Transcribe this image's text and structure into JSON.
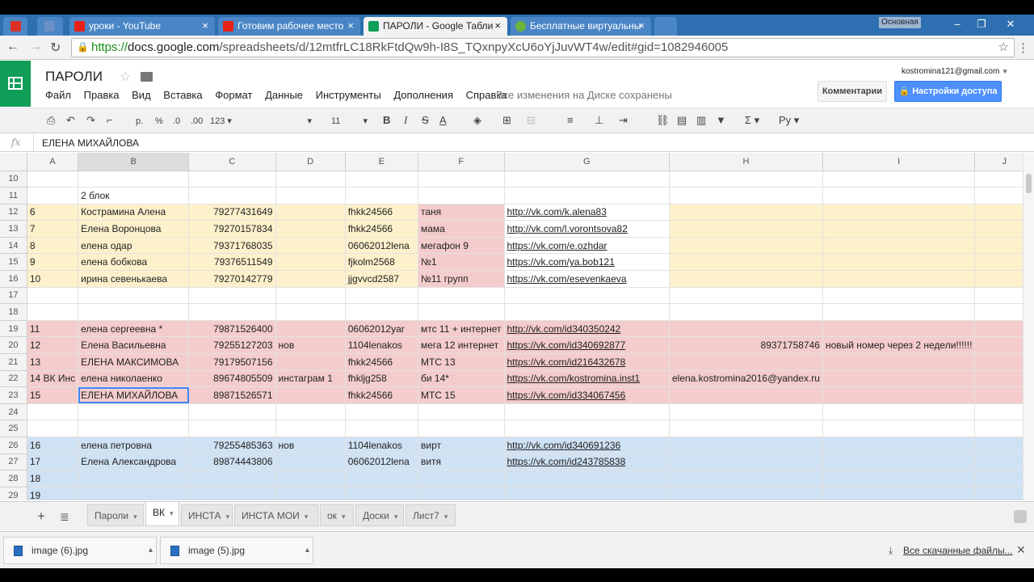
{
  "browser": {
    "tabs": [
      {
        "label": "",
        "favicon_color": "#d93025"
      },
      {
        "label": "",
        "favicon_color": "#6b8fc7"
      },
      {
        "label": "уроки - YouTube",
        "favicon_color": "#e62117"
      },
      {
        "label": "Готовим рабочее место",
        "favicon_color": "#e62117"
      },
      {
        "label": "ПАРОЛИ - Google Табли",
        "favicon_color": "#0f9d58"
      },
      {
        "label": "Бесплатные виртуальны",
        "favicon_color": "#6bb33a"
      }
    ],
    "profile_label": "Основная",
    "url_scheme": "https://",
    "url_host": "docs.google.com",
    "url_path": "/spreadsheets/d/12mtfrLC18RkFtdQw9h-I8S_TQxnpyXcU6oYjJuvWT4w/edit#gid=1082946005"
  },
  "doc": {
    "title": "ПАРОЛИ",
    "menu": [
      "Файл",
      "Правка",
      "Вид",
      "Вставка",
      "Формат",
      "Данные",
      "Инструменты",
      "Дополнения",
      "Справка"
    ],
    "saved_status": "Все изменения на Диске сохранены",
    "account": "kostromina121@gmail.com",
    "comments_label": "Комментарии",
    "share_label": "Настройки доступа"
  },
  "toolbar": {
    "currency": "р.",
    "percent": "%",
    "dec_less": ".0",
    "dec_more": ".00",
    "format_more": "123",
    "font_size": "11",
    "bold": "B",
    "italic": "I",
    "strike": "S",
    "text_color": "A",
    "sigma": "Σ",
    "input_lang": "Ру"
  },
  "formula": {
    "fx": "fx",
    "value": "ЕЛЕНА МИХАЙЛОВА"
  },
  "sheet": {
    "columns": [
      "A",
      "B",
      "C",
      "D",
      "E",
      "F",
      "G",
      "H",
      "I",
      "J"
    ],
    "selected_column": "B",
    "rows": [
      {
        "n": "10",
        "color": "",
        "cells": [
          "",
          "",
          "",
          "",
          "",
          "",
          "",
          "",
          "",
          ""
        ]
      },
      {
        "n": "11",
        "color": "",
        "cells": [
          "",
          "2 блок",
          "",
          "",
          "",
          "",
          "",
          "",
          "",
          ""
        ]
      },
      {
        "n": "12",
        "color": "yellow",
        "cells": [
          "6",
          "Кострамина Алена",
          "79277431649",
          "",
          "fhkk24566",
          "таня",
          "http://vk.com/k.alena83",
          "",
          "",
          ""
        ]
      },
      {
        "n": "13",
        "color": "yellow",
        "cells": [
          "7",
          "Елена Воронцова",
          "79270157834",
          "",
          "fhkk24566",
          "мама",
          "http://vk.com/l.vorontsova82",
          "",
          "",
          ""
        ]
      },
      {
        "n": "14",
        "color": "yellow",
        "cells": [
          "8",
          "елена одар",
          "79371768035",
          "",
          "06062012lena",
          "мегафон 9",
          "https://vk.com/e.ozhdar",
          "",
          "",
          ""
        ]
      },
      {
        "n": "15",
        "color": "yellow",
        "cells": [
          "9",
          "елена бобкова",
          "79376511549",
          "",
          "fjkolm2568",
          "№1",
          "https://vk.com/ya.bob121",
          "",
          "",
          ""
        ]
      },
      {
        "n": "16",
        "color": "yellow",
        "cells": [
          "10",
          "ирина севенькаева",
          "79270142779",
          "",
          "jjgvvcd2587",
          "№11 групп",
          "https://vk.com/esevenkaeva",
          "",
          "",
          ""
        ]
      },
      {
        "n": "17",
        "color": "",
        "cells": [
          "",
          "",
          "",
          "",
          "",
          "",
          "",
          "",
          "",
          ""
        ]
      },
      {
        "n": "18",
        "color": "",
        "cells": [
          "",
          "",
          "",
          "",
          "",
          "",
          "",
          "",
          "",
          ""
        ]
      },
      {
        "n": "19",
        "color": "red",
        "cells": [
          "11",
          "елена сергеевна *",
          "79871526400",
          "",
          "06062012yar",
          "мтс 11 + интернет",
          "http://vk.com/id340350242",
          "",
          "",
          ""
        ]
      },
      {
        "n": "20",
        "color": "red",
        "cells": [
          "12",
          "Елена Васильевна",
          "79255127203",
          "нов",
          "1104lenakos",
          "мега 12 интернет",
          "https://vk.com/id340692877",
          "89371758746",
          "новый номер через 2 недели!!!!!!",
          ""
        ]
      },
      {
        "n": "21",
        "color": "red",
        "cells": [
          "13",
          "ЕЛЕНА МАКСИМОВА",
          "79179507156",
          "",
          "fhkk24566",
          "МТС 13",
          "https://vk.com/id216432678",
          "",
          "",
          ""
        ]
      },
      {
        "n": "22",
        "color": "red",
        "cells": [
          "14 ВК Инс",
          "елена николаенко",
          "89674805509",
          "инстаграм 1",
          "fhkljg258",
          "би 14*",
          "https://vk.com/kostromina.inst1",
          "elena.kostromina2016@yandex.ru",
          "",
          ""
        ]
      },
      {
        "n": "23",
        "color": "red",
        "cells": [
          "15",
          "ЕЛЕНА МИХАЙЛОВА",
          "89871526571",
          "",
          "fhkk24566",
          "МТС 15",
          "https://vk.com/id334067456",
          "",
          "",
          ""
        ]
      },
      {
        "n": "24",
        "color": "",
        "cells": [
          "",
          "",
          "",
          "",
          "",
          "",
          "",
          "",
          "",
          ""
        ]
      },
      {
        "n": "25",
        "color": "",
        "cells": [
          "",
          "",
          "",
          "",
          "",
          "",
          "",
          "",
          "",
          ""
        ]
      },
      {
        "n": "26",
        "color": "blue",
        "cells": [
          "16",
          "елена петровна",
          "79255485363",
          "нов",
          "1104lenakos",
          "вирт",
          "http://vk.com/id340691236",
          "",
          "",
          ""
        ]
      },
      {
        "n": "27",
        "color": "blue",
        "cells": [
          "17",
          "Елена Александрова",
          "89874443806",
          "",
          "06062012lena",
          "витя",
          "https://vk.com/id243785838",
          "",
          "",
          ""
        ]
      },
      {
        "n": "28",
        "color": "blue",
        "cells": [
          "18",
          "",
          "",
          "",
          "",
          "",
          "",
          "",
          "",
          ""
        ]
      },
      {
        "n": "29",
        "color": "blue",
        "cells": [
          "19",
          "",
          "",
          "",
          "",
          "",
          "",
          "",
          "",
          ""
        ]
      }
    ],
    "colors": {
      "yellow": "#fdf1cc",
      "red": "#f4cccc",
      "blue": "#cfe2f3",
      "selection": "#4285f4"
    }
  },
  "sheet_tabs": [
    {
      "label": "Пароли",
      "active": false
    },
    {
      "label": "ВК",
      "active": true
    },
    {
      "label": "ИНСТА",
      "active": false
    },
    {
      "label": "ИНСТА МОИ",
      "active": false
    },
    {
      "label": "ок",
      "active": false
    },
    {
      "label": "Доски",
      "active": false
    },
    {
      "label": "Лист7",
      "active": false
    }
  ],
  "downloads": {
    "items": [
      "image (6).jpg",
      "image (5).jpg"
    ],
    "all_label": "Все скачанные файлы..."
  }
}
